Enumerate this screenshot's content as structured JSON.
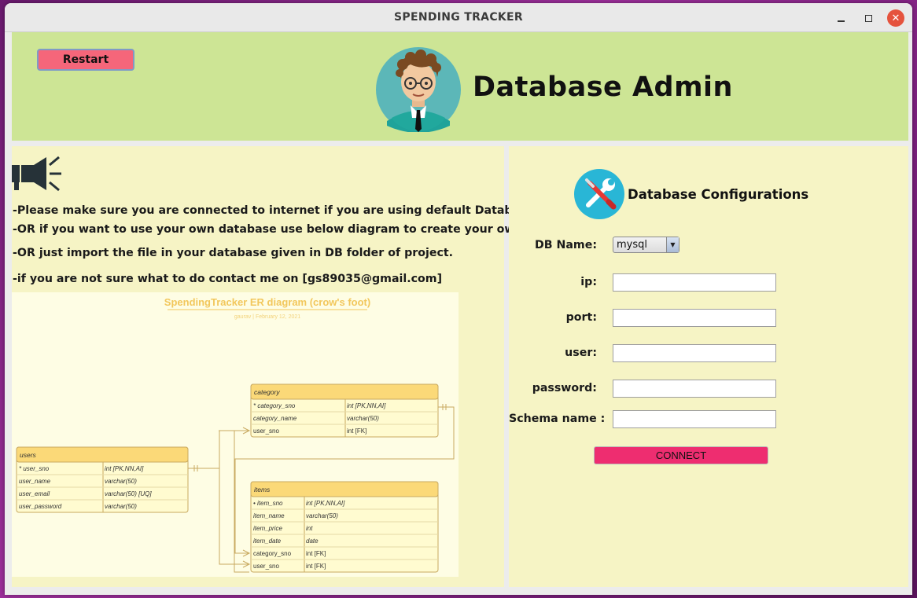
{
  "window": {
    "title": "SPENDING TRACKER"
  },
  "header": {
    "restart_label": "Restart",
    "title": "Database Admin"
  },
  "left": {
    "notices": [
      "-Please make sure you are connected to internet if you are using default Database.",
      "-OR if you want to use your own database  use below diagram to create your own table.",
      "-OR just import the file in your database given in DB folder of project.",
      "-if you are not sure what to do contact me on [gs89035@gmail.com]"
    ],
    "diagram": {
      "title": "SpendingTracker ER diagram (crow's foot)",
      "subtitle": "gaurav  |  February 12, 2021",
      "tables": [
        {
          "name": "category",
          "rows": [
            [
              "* category_sno",
              "int [PK,NN,AI]"
            ],
            [
              "category_name",
              "varchar(50)"
            ],
            [
              "user_sno",
              "int [FK]"
            ]
          ]
        },
        {
          "name": "users",
          "rows": [
            [
              "* user_sno",
              "int [PK,NN,AI]"
            ],
            [
              "user_name",
              "varchar(50)"
            ],
            [
              "user_email",
              "varchar(50) [UQ]"
            ],
            [
              "user_password",
              "varchar(50)"
            ]
          ]
        },
        {
          "name": "items",
          "rows": [
            [
              "• item_sno",
              "int  [PK,NN,AI]"
            ],
            [
              "item_name",
              "varchar(50)"
            ],
            [
              "item_price",
              "int"
            ],
            [
              "item_date",
              "date"
            ],
            [
              "category_sno",
              "int  [FK]"
            ],
            [
              "user_sno",
              "int  [FK]"
            ]
          ]
        }
      ]
    }
  },
  "config": {
    "title": "Database Configurations",
    "db_name_label": "DB Name:",
    "db_name_value": "mysql",
    "ip_label": "ip:",
    "port_label": "port:",
    "user_label": "user:",
    "password_label": "password:",
    "schema_label": "Schema name :",
    "ip_value": "",
    "port_value": "",
    "user_value": "",
    "password_value": "",
    "schema_value": "",
    "connect_label": "CONNECT"
  },
  "colors": {
    "header_bg": "#cde595",
    "panel_bg": "#f6f4c5",
    "restart_bg": "#f5667a",
    "connect_bg": "#ee2d70",
    "er_header": "#fbd978"
  }
}
